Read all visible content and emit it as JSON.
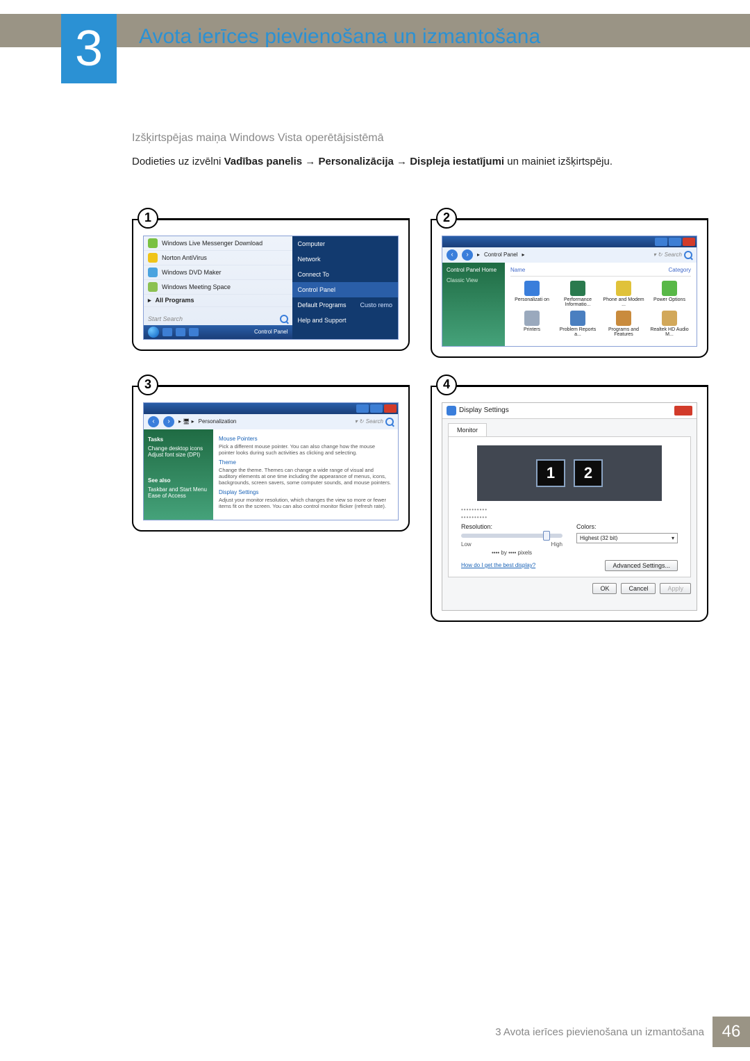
{
  "chapter": {
    "number": "3",
    "title": "Avota ierīces pievienošana un izmantošana"
  },
  "section": {
    "subheading": "Izšķirtspējas maiņa Windows Vista operētājsistēmā",
    "instruction_prefix": "Dodieties uz izvēlni ",
    "path1": "Vadības panelis",
    "path2": "Personalizācija",
    "path3": "Displeja iestatījumi",
    "instruction_suffix": " un mainiet izšķirtspēju.",
    "arrow": "→"
  },
  "badges": {
    "b1": "1",
    "b2": "2",
    "b3": "3",
    "b4": "4"
  },
  "shot1": {
    "items": {
      "msn": "Windows Live Messenger Download",
      "av": "Norton AntiVirus",
      "dvd": "Windows DVD Maker",
      "meet": "Windows Meeting Space",
      "all": "All Programs"
    },
    "search_placeholder": "Start Search",
    "taskbar_cp": "Control Panel",
    "right": {
      "computer": "Computer",
      "network": "Network",
      "connect": "Connect To",
      "control_panel": "Control Panel",
      "default_programs": "Default Programs",
      "custo": "Custo remo",
      "help": "Help and Support"
    }
  },
  "shot2": {
    "crumb": "Control Panel",
    "search": "Search",
    "side": {
      "home": "Control Panel Home",
      "classic": "Classic View"
    },
    "cols": {
      "name": "Name",
      "category": "Category"
    },
    "icons": {
      "personalization": "Personalizati on",
      "performance": "Performance Informatio...",
      "phone": "Phone and Modem ...",
      "power": "Power Options",
      "printers": "Printers",
      "problem": "Problem Reports a...",
      "programs": "Programs and Features",
      "realtek": "Realtek HD Audio M..."
    }
  },
  "shot3": {
    "crumb": "Personalization",
    "search": "Search",
    "side": {
      "tasks": "Tasks",
      "desktop_icons": "Change desktop icons",
      "font_size": "Adjust font size (DPI)",
      "see_also": "See also",
      "taskbar": "Taskbar and Start Menu",
      "ease": "Ease of Access"
    },
    "main": {
      "mouse_title": "Mouse Pointers",
      "mouse_desc": "Pick a different mouse pointer. You can also change how the mouse pointer looks during such activities as clicking and selecting.",
      "theme_title": "Theme",
      "theme_desc": "Change the theme. Themes can change a wide range of visual and auditory elements at one time including the appearance of menus, icons, backgrounds, screen savers, some computer sounds, and mouse pointers.",
      "display_title": "Display Settings",
      "display_desc": "Adjust your monitor resolution, which changes the view so more or fewer items fit on the screen. You can also control monitor flicker (refresh rate)."
    }
  },
  "shot4": {
    "title": "Display Settings",
    "tab": "Monitor",
    "mon1": "1",
    "mon2": "2",
    "dots": "••••••••••",
    "resolution_label": "Resolution:",
    "low": "Low",
    "high": "High",
    "pixels": "•••• by •••• pixels",
    "colors_label": "Colors:",
    "colors_value": "Highest (32 bit)",
    "help_link": "How do I get the best display?",
    "advanced": "Advanced Settings...",
    "ok": "OK",
    "cancel": "Cancel",
    "apply": "Apply"
  },
  "footer": {
    "text": "3 Avota ierīces pievienošana un izmantošana",
    "page": "46"
  }
}
